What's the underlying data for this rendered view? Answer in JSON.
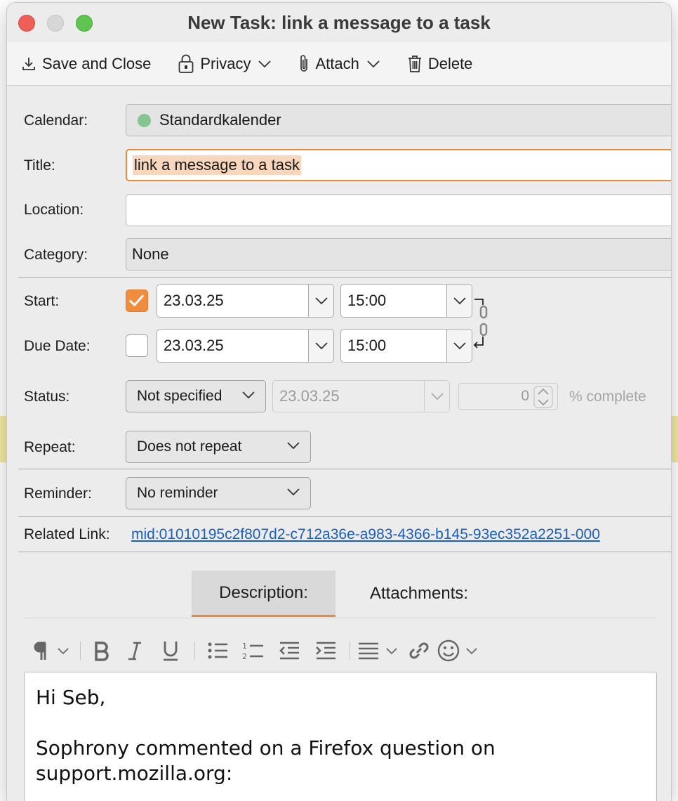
{
  "window": {
    "title": "New Task: link a message to a task"
  },
  "toolbar": {
    "save_close": "Save and Close",
    "privacy": "Privacy",
    "attach": "Attach",
    "delete": "Delete"
  },
  "form": {
    "calendar_label": "Calendar:",
    "calendar_value": "Standardkalender",
    "calendar_color": "#86c490",
    "title_label": "Title:",
    "title_value": "link a message to a task",
    "location_label": "Location:",
    "location_value": "",
    "category_label": "Category:",
    "category_value": "None",
    "start_label": "Start:",
    "start_checked": true,
    "start_date": "23.03.25",
    "start_time": "15:00",
    "due_label": "Due Date:",
    "due_checked": false,
    "due_date": "23.03.25",
    "due_time": "15:00",
    "status_label": "Status:",
    "status_value": "Not specified",
    "status_date": "23.03.25",
    "percent_value": "0",
    "percent_label": "% complete",
    "repeat_label": "Repeat:",
    "repeat_value": "Does not repeat",
    "reminder_label": "Reminder:",
    "reminder_value": "No reminder",
    "related_label": "Related Link:",
    "related_value": "mid:01010195c2f807d2-c712a36e-a983-4366-b145-93ec352a2251-000"
  },
  "tabs": {
    "description": "Description:",
    "attachments": "Attachments:"
  },
  "editor": {
    "line1": "Hi Seb,",
    "line2": "Sophrony commented on a Firefox question on",
    "line3": "support.mozilla.org:"
  },
  "colors": {
    "accent": "#e98a3a",
    "link": "#1a5fbf"
  }
}
